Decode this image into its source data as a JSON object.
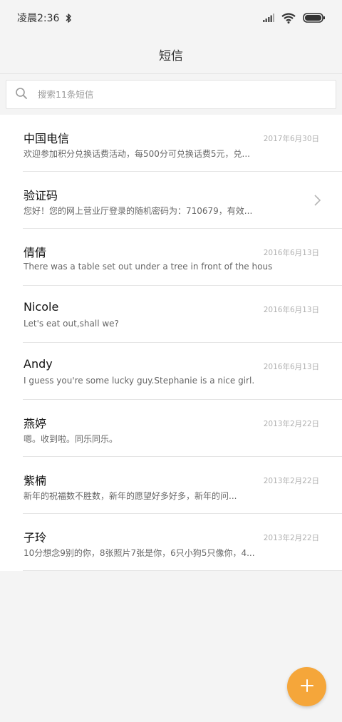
{
  "status_bar": {
    "time": "凌晨2:36"
  },
  "app_bar": {
    "title": "短信"
  },
  "search": {
    "placeholder": "搜索11条短信"
  },
  "conversations": [
    {
      "name": "中国电信",
      "date": "2017年6月30日",
      "preview": "欢迎参加积分兑换话费活动，每500分可兑换话费5元，兑..."
    },
    {
      "name": "验证码",
      "date": "",
      "preview": "您好！您的网上营业厅登录的随机密码为：710679，有效..."
    },
    {
      "name": "倩倩",
      "date": "2016年6月13日",
      "preview": "There was a table set out under a tree in front of the hous"
    },
    {
      "name": "Nicole",
      "date": "2016年6月13日",
      "preview": "Let's eat out,shall we?"
    },
    {
      "name": "Andy",
      "date": "2016年6月13日",
      "preview": "I guess you're some lucky guy.Stephanie is a nice girl."
    },
    {
      "name": "燕婷",
      "date": "2013年2月22日",
      "preview": "嗯。收到啦。同乐同乐。"
    },
    {
      "name": "紫楠",
      "date": "2013年2月22日",
      "preview": "新年的祝福数不胜数，新年的愿望好多好多，新年的问..."
    },
    {
      "name": "子玲",
      "date": "2013年2月22日",
      "preview": "10分想念9别的你，8张照片7张是你，6只小狗5只像你，4..."
    }
  ],
  "colors": {
    "fab": "#f5a63a",
    "background": "#f4f4f4"
  }
}
